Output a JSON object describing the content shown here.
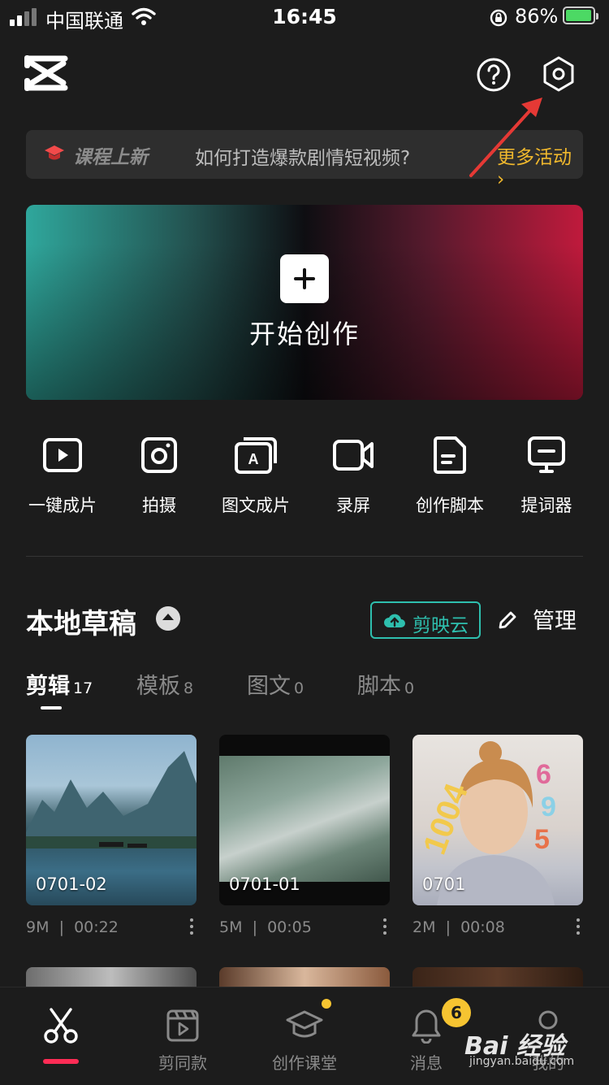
{
  "status_bar": {
    "carrier": "中国联通",
    "time": "16:45",
    "battery_pct": "86%",
    "battery_level": 0.86
  },
  "header": {
    "logo_icon": "capcut-logo-icon",
    "help_icon": "help-circle-icon",
    "settings_icon": "settings-hexagon-icon"
  },
  "banner": {
    "tag": "课程上新",
    "text": "如何打造爆款剧情短视频?",
    "more": "更多活动"
  },
  "hero": {
    "label": "开始创作"
  },
  "tools": [
    {
      "label": "一键成片",
      "icon": "play-square-icon"
    },
    {
      "label": "拍摄",
      "icon": "camera-icon"
    },
    {
      "label": "图文成片",
      "icon": "text-to-video-icon"
    },
    {
      "label": "录屏",
      "icon": "video-camera-icon"
    },
    {
      "label": "创作脚本",
      "icon": "script-doc-icon"
    },
    {
      "label": "提词器",
      "icon": "teleprompter-icon"
    }
  ],
  "drafts": {
    "title": "本地草稿",
    "cloud_label": "剪映云",
    "manage_label": "管理",
    "tabs": [
      {
        "label": "剪辑",
        "count": "17"
      },
      {
        "label": "模板",
        "count": "8"
      },
      {
        "label": "图文",
        "count": "0"
      },
      {
        "label": "脚本",
        "count": "0"
      }
    ],
    "items": [
      {
        "name": "0701-02",
        "size": "9M",
        "duration": "00:22"
      },
      {
        "name": "0701-01",
        "size": "5M",
        "duration": "00:05"
      },
      {
        "name": "0701",
        "size": "2M",
        "duration": "00:08"
      }
    ],
    "separator": "|"
  },
  "nav": [
    {
      "label": "",
      "icon": "scissors-icon"
    },
    {
      "label": "剪同款",
      "icon": "clapper-icon"
    },
    {
      "label": "创作课堂",
      "icon": "graduation-cap-icon"
    },
    {
      "label": "消息",
      "icon": "bell-icon",
      "badge": "6"
    },
    {
      "label": "我的",
      "icon": "person-icon"
    }
  ],
  "watermark": {
    "main": "Bai 经验",
    "sub": "jingyan.baidu.com"
  },
  "colors": {
    "background": "#1c1c1c",
    "accent_teal": "#2ebfae",
    "accent_yellow": "#f0b82d",
    "accent_red": "#fe2c55"
  }
}
